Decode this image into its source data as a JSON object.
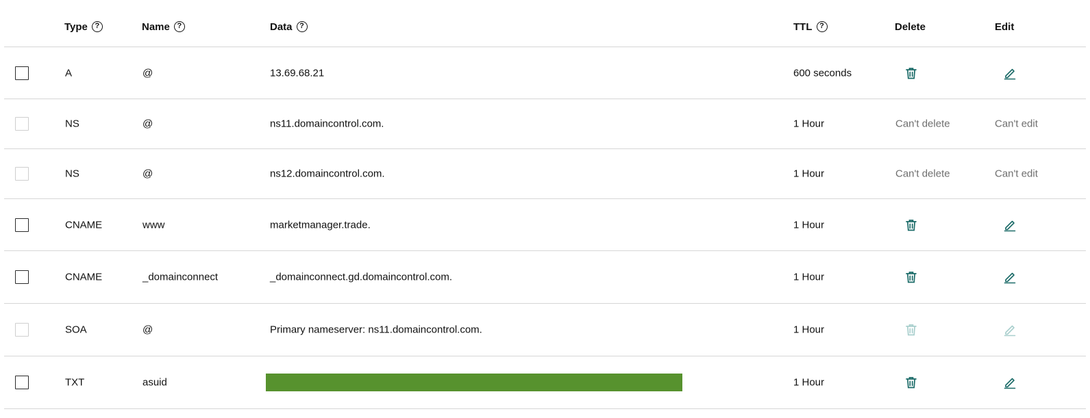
{
  "headers": {
    "type": "Type",
    "name": "Name",
    "data": "Data",
    "ttl": "TTL",
    "delete": "Delete",
    "edit": "Edit",
    "help_glyph": "?"
  },
  "labels": {
    "cant_delete": "Can't delete",
    "cant_edit": "Can't edit"
  },
  "colors": {
    "icon": "#1b6b68",
    "icon_disabled": "#a9cfcd",
    "redaction": "#57922e"
  },
  "records": [
    {
      "type": "A",
      "name": "@",
      "data": "13.69.68.21",
      "ttl": "600 seconds",
      "actions": "icons",
      "checkbox_enabled": true
    },
    {
      "type": "NS",
      "name": "@",
      "data": "ns11.domaincontrol.com.",
      "ttl": "1 Hour",
      "actions": "text",
      "checkbox_enabled": false
    },
    {
      "type": "NS",
      "name": "@",
      "data": "ns12.domaincontrol.com.",
      "ttl": "1 Hour",
      "actions": "text",
      "checkbox_enabled": false
    },
    {
      "type": "CNAME",
      "name": "www",
      "data": "marketmanager.trade.",
      "ttl": "1 Hour",
      "actions": "icons",
      "checkbox_enabled": true
    },
    {
      "type": "CNAME",
      "name": "_domainconnect",
      "data": "_domainconnect.gd.domaincontrol.com.",
      "ttl": "1 Hour",
      "actions": "icons",
      "checkbox_enabled": true
    },
    {
      "type": "SOA",
      "name": "@",
      "data": "Primary nameserver: ns11.domaincontrol.com.",
      "ttl": "1 Hour",
      "actions": "icons-disabled",
      "checkbox_enabled": false
    },
    {
      "type": "TXT",
      "name": "asuid",
      "data": "",
      "data_redacted": true,
      "ttl": "1 Hour",
      "actions": "icons",
      "checkbox_enabled": true
    }
  ]
}
